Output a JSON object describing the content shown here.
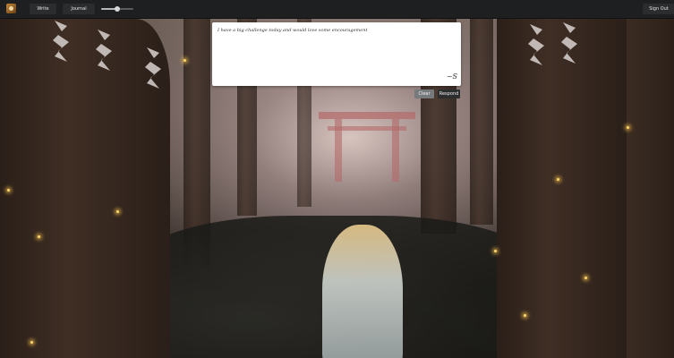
{
  "nav": {
    "write_label": "Write",
    "journal_label": "Journal",
    "signout_label": "Sign Out",
    "volume_level": 0.5
  },
  "journal": {
    "entry_text": "I have a big challenge today and would love some encouragement",
    "signature": "~S"
  },
  "actions": {
    "clear_label": "Clear",
    "respond_label": "Respond"
  },
  "icons": {
    "logo": "avatar-logo-icon"
  }
}
